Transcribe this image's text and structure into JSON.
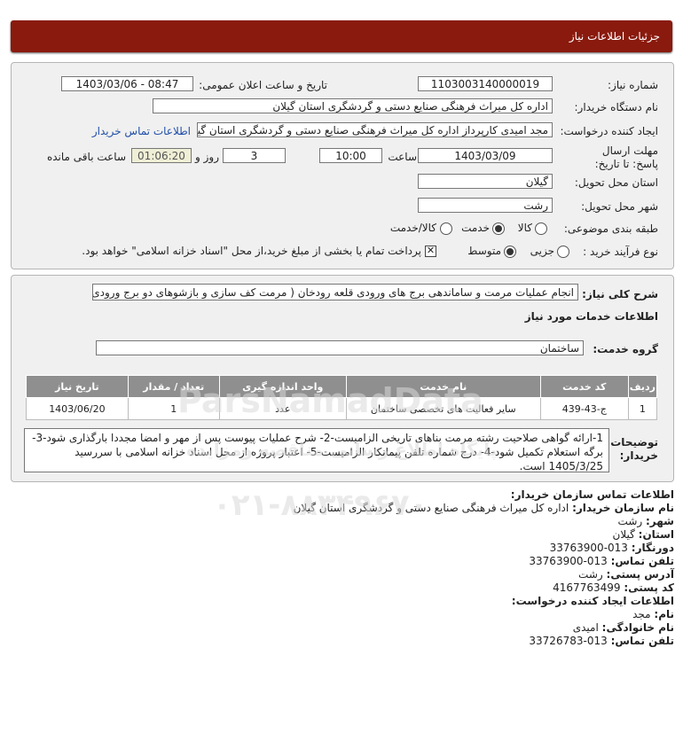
{
  "header": {
    "title": "جزئیات اطلاعات نیاز"
  },
  "form": {
    "need_number_label": "شماره نیاز:",
    "need_number": "1103003140000019",
    "announce_label": "تاریخ و ساعت اعلان عمومی:",
    "announce_value": "1403/03/06 - 08:47",
    "buyer_org_label": "نام دستگاه خریدار:",
    "buyer_org": "اداره کل میراث فرهنگی  صنایع دستی و گردشگری استان گیلان",
    "creator_label": "ایجاد کننده درخواست:",
    "creator": "مجد امیدی کارپرداز اداره کل میراث فرهنگی  صنایع دستی و گردشگری استان گیلان",
    "contact_link": "اطلاعات تماس خریدار",
    "deadline_label": "مهلت ارسال پاسخ: تا تاریخ:",
    "deadline_date": "1403/03/09",
    "time_label": "ساعت",
    "deadline_time": "10:00",
    "days_value": "3",
    "days_label": "روز و",
    "remaining_time": "01:06:20",
    "remaining_label": "ساعت باقی مانده",
    "province_label": "استان محل تحویل:",
    "province": "گیلان",
    "city_label": "شهر محل تحویل:",
    "city": "رشت",
    "category_label": "طبقه بندی موضوعی:",
    "category_options": [
      "کالا",
      "خدمت",
      "کالا/خدمت"
    ],
    "category_selected": "خدمت",
    "process_label": "نوع فرآیند خرید :",
    "process_options": [
      "جزیی",
      "متوسط"
    ],
    "process_selected": "متوسط",
    "payment_note": "پرداخت تمام یا بخشی از مبلغ خرید،از محل \"اسناد خزانه اسلامی\" خواهد بود."
  },
  "summary": {
    "label": "شرح کلی نیاز:",
    "text": "انجام عملیات مرمت و ساماندهی برج های ورودی قلعه رودخان ( مرمت کف سازی و بازشوهای دو برج ورودی)",
    "services_title": "اطلاعات خدمات مورد نیاز",
    "service_group_label": "گروه خدمت:",
    "service_group": "ساختمان"
  },
  "table": {
    "headers": [
      "ردیف",
      "کد خدمت",
      "نام خدمت",
      "واحد اندازه گیری",
      "تعداد / مقدار",
      "تاریخ نیاز"
    ],
    "rows": [
      [
        "1",
        "ج-43-439",
        "سایر فعالیت های تخصصی ساختمان",
        "عدد",
        "1",
        "1403/06/20"
      ]
    ]
  },
  "notes": {
    "label": "توضیحات خریدار:",
    "text": "1-ارائه گواهی صلاحیت رشته مرمت بناهای تاریخی الزامیست-2- شرح عملیات پیوست پس از مهر و امضا مجددا بارگذاری شود-3-برگه استعلام تکمیل شود-4- درج شماره تلفن پیمانکار الزامیست-5- اعتبار پروژه از محل اسناد خزانه اسلامی با سررسید 1405/3/25 است."
  },
  "buyer_contact": {
    "title": "اطلاعات تماس سازمان خریدار:",
    "org_label": "نام سازمان خریدار:",
    "org": "اداره کل میراث فرهنگی صنایع دستی و گردشگری استان گیلان",
    "city_label": "شهر:",
    "city": "رشت",
    "province_label": "استان:",
    "province": "گیلان",
    "fax_label": "دورنگار:",
    "fax": "013-33763900",
    "phone_label": "تلفن تماس:",
    "phone": "013-33763900",
    "address_label": "آدرس پستی:",
    "address": "رشت",
    "postal_label": "کد پستی:",
    "postal": "4167763499"
  },
  "creator_contact": {
    "title": "اطلاعات ایجاد کننده درخواست:",
    "name_label": "نام:",
    "name": "مجد",
    "family_label": "نام خانوادگی:",
    "family": "امیدی",
    "phone_label": "تلفن تماس:",
    "phone": "013-33726783"
  },
  "watermark": {
    "brand": "ParsNamadData",
    "phone": "۰۲۱-۸۸۳۴۹۶۷۰",
    "caption": "پایگاه اطلاع رسانی مناقصه ومزایده"
  }
}
